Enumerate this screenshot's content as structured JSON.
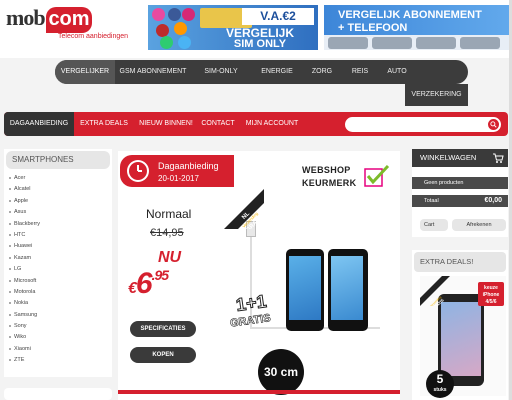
{
  "header": {
    "logo_mob": "mob",
    "logo_com": "com",
    "tagline": "Telecom aanbiedingen",
    "banner1": {
      "badge": "V.A.€2",
      "line1": "VERGELIJK",
      "line2": "SIM ONLY"
    },
    "banner2": {
      "line1": "VERGELIJK ABONNEMENT",
      "line2": "+ TELEFOON"
    }
  },
  "main_nav": {
    "items": [
      "VERGELIJKER",
      "GSM ABONNEMENT",
      "SIM-ONLY",
      "ENERGIE",
      "ZORG",
      "REIS",
      "AUTO"
    ],
    "overflow": "VERZEKERING"
  },
  "sub_nav": {
    "items": [
      "DAGAANBIEDING",
      "EXTRA DEALS",
      "NIEUW BINNEN!",
      "CONTACT",
      "MIJN ACCOUNT"
    ],
    "search_placeholder": ""
  },
  "sidebar": {
    "title": "SMARTPHONES",
    "brands": [
      "Acer",
      "Alcatel",
      "Apple",
      "Asus",
      "Blackberry",
      "HTC",
      "Huawei",
      "Kazam",
      "LG",
      "Microsoft",
      "Motorola",
      "Nokia",
      "Samsung",
      "Sony",
      "Wiko",
      "Xiaomi",
      "ZTE"
    ]
  },
  "deal": {
    "title": "Dagaanbieding",
    "date": "20-01-2017",
    "webshop_line1": "WEBSHOP",
    "webshop_line2": "KEURMERK",
    "normal_label": "Normaal",
    "old_price": "€14,95",
    "now_label": "NU",
    "new_price_euro": "€",
    "new_price_int": "6",
    "new_price_cents": ".95",
    "ribbon_lines": [
      "NL",
      "Verzending",
      "GRATIS"
    ],
    "one_plus_one": "1+1",
    "free_label": "GRATIS",
    "cable_length": "30 cm",
    "specs_button": "SPECIFICATIES",
    "buy_button": "KOPEN"
  },
  "cart": {
    "title": "WINKELWAGEN",
    "empty_text": "Geen producten",
    "total_label": "Totaal",
    "total_amount": "€0,00",
    "cart_button": "Cart",
    "checkout_button": "Afrekenen"
  },
  "extra_deals": {
    "title": "EXTRA DEALS!",
    "badge_line1": "keuze",
    "badge_line2": "iPhone",
    "badge_line3": "4/5/6",
    "ribbon_lines": [
      "NL",
      "Verzending",
      "GRATIS"
    ],
    "count_number": "5",
    "count_label": "stuks"
  },
  "colors": {
    "brand_red": "#d5202e",
    "nav_dark": "#3c3c3c"
  }
}
